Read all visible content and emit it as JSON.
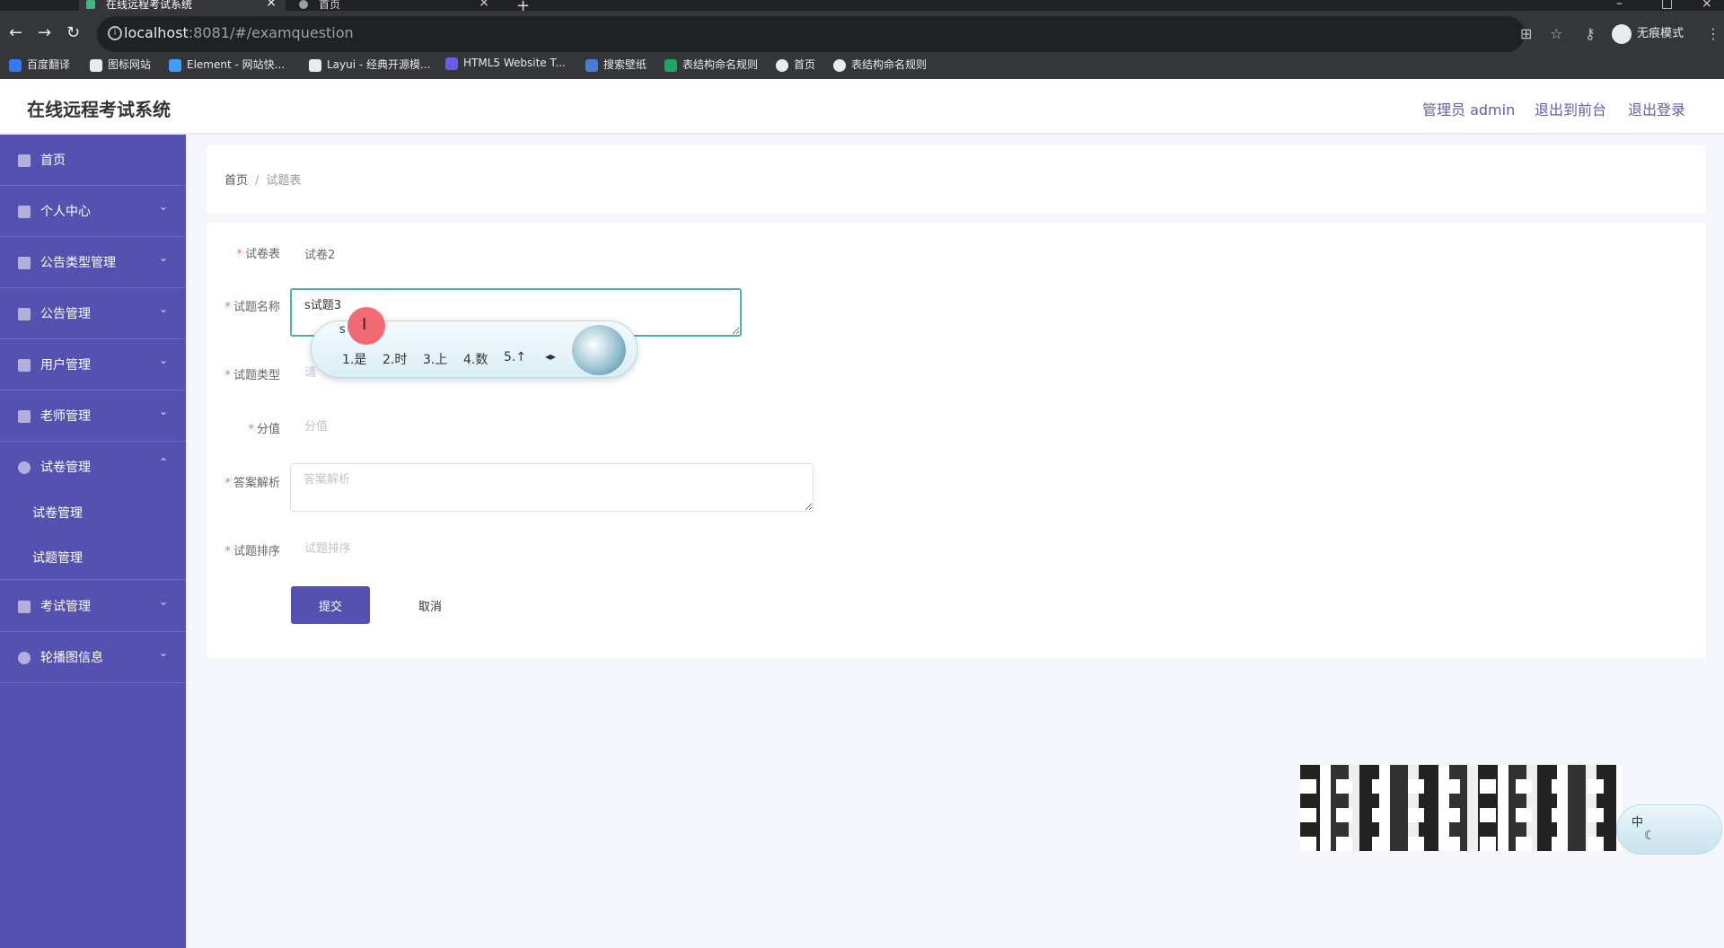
{
  "browser": {
    "tabs": [
      {
        "title": "在线远程考试系统",
        "active": true
      },
      {
        "title": "首页",
        "active": false
      }
    ],
    "url_host": "localhost",
    "url_rest": ":8081/#/examquestion",
    "incognito_label": "无痕模式",
    "bookmarks": [
      {
        "label": "百度翻译",
        "color": "#2f7cf6"
      },
      {
        "label": "图标网站",
        "color": "#e8eaed"
      },
      {
        "label": "Element - 网站快...",
        "color": "#409eff"
      },
      {
        "label": "Layui - 经典开源模...",
        "color": "#e8eaed"
      },
      {
        "label": "HTML5 Website T...",
        "color": "#6b5ce7"
      },
      {
        "label": "搜索壁纸",
        "color": "#4a7bd6"
      },
      {
        "label": "表结构命名规则",
        "color": "#1fa463"
      },
      {
        "label": "首页",
        "color": "#e8eaed"
      },
      {
        "label": "表结构命名规则",
        "color": "#e8eaed"
      }
    ]
  },
  "header": {
    "title": "在线远程考试系统",
    "admin_label": "管理员 admin",
    "to_front_label": "退出到前台",
    "logout_label": "退出登录"
  },
  "sidebar": {
    "items": [
      {
        "label": "首页",
        "icon": "home-icon",
        "has_children": false
      },
      {
        "label": "个人中心",
        "icon": "user-icon",
        "has_children": true
      },
      {
        "label": "公告类型管理",
        "icon": "list-icon",
        "has_children": true
      },
      {
        "label": "公告管理",
        "icon": "bar-chart-icon",
        "has_children": true
      },
      {
        "label": "用户管理",
        "icon": "grid-icon",
        "has_children": true
      },
      {
        "label": "老师管理",
        "icon": "user-icon",
        "has_children": true
      },
      {
        "label": "试卷管理",
        "icon": "circle-icon",
        "has_children": true,
        "expanded": true
      },
      {
        "label": "考试管理",
        "icon": "list-icon",
        "has_children": true
      },
      {
        "label": "轮播图信息",
        "icon": "circle-icon",
        "has_children": true
      }
    ],
    "sub_items": [
      "试卷管理",
      "试题管理"
    ]
  },
  "breadcrumb": {
    "home": "首页",
    "separator": "/",
    "current": "试题表"
  },
  "form": {
    "paper": {
      "label": "试卷表",
      "value": "试卷2"
    },
    "name": {
      "label": "试题名称",
      "value": "s试题3"
    },
    "type": {
      "label": "试题类型",
      "placeholder": "请"
    },
    "score": {
      "label": "分值",
      "placeholder": "分值"
    },
    "analysis": {
      "label": "答案解析",
      "placeholder": "答案解析"
    },
    "order": {
      "label": "试题排序",
      "placeholder": "试题排序"
    },
    "submit_label": "提交",
    "cancel_label": "取消"
  },
  "ime": {
    "pinyin": "s",
    "candidates": [
      "1.是",
      "2.时",
      "3.上",
      "4.数",
      "5.↑"
    ],
    "status_label": "中"
  },
  "colors": {
    "sidebar_bg": "#5451b0",
    "accent": "#5451b0",
    "required": "#f56c6c"
  }
}
